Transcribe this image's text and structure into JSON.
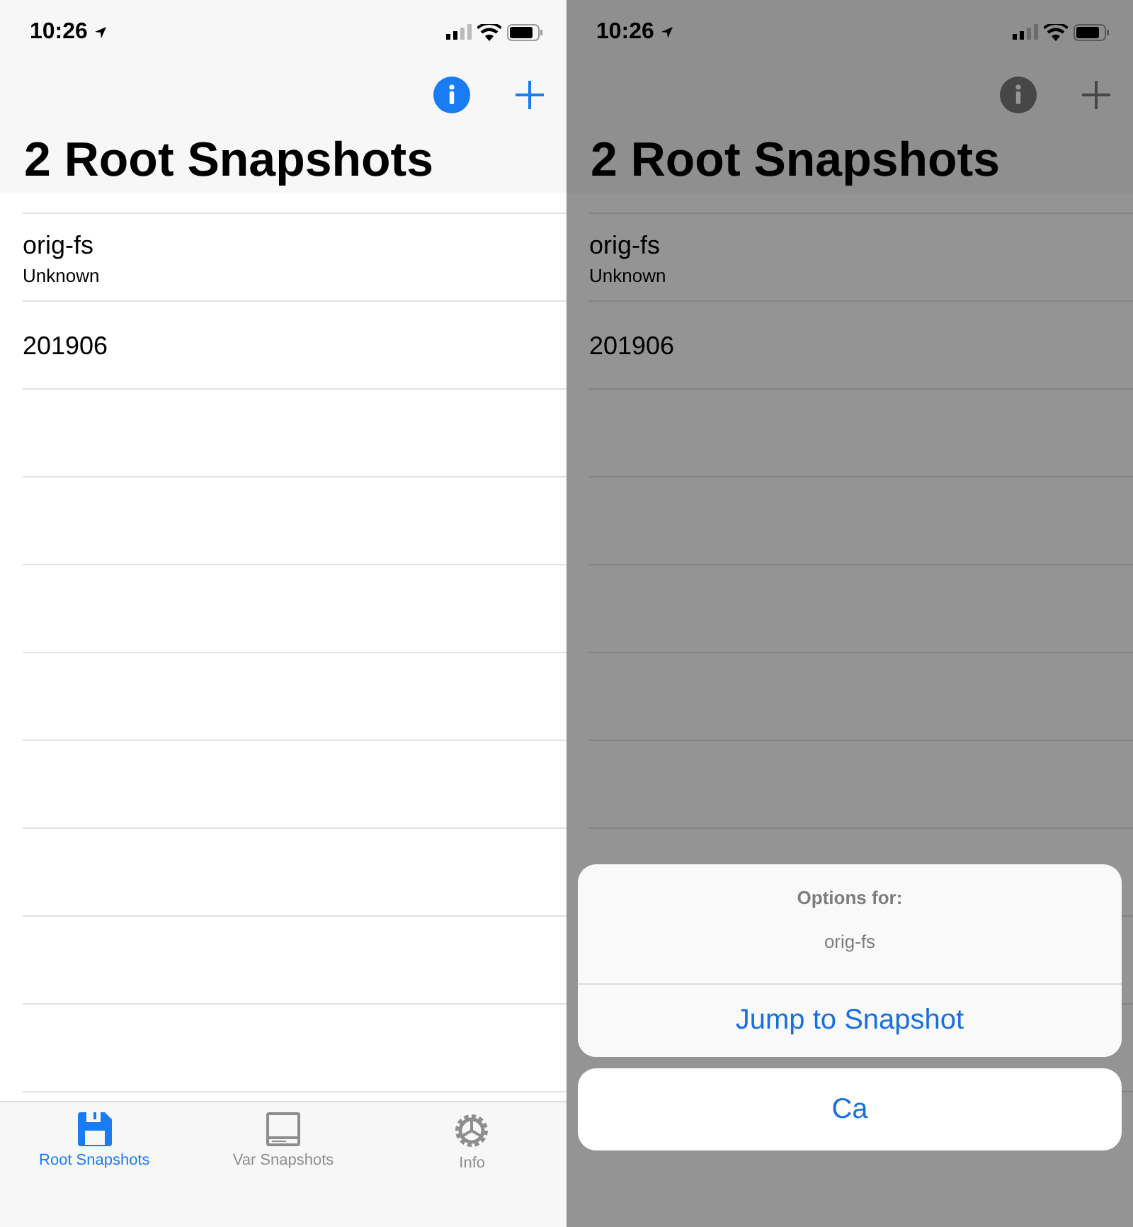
{
  "screens": [
    {
      "dimmed": false,
      "status_bar": {
        "time": "10:26"
      },
      "title": "2 Root Snapshots",
      "rows": [
        {
          "title": "orig-fs",
          "subtitle": "Unknown"
        },
        {
          "title": "201906"
        }
      ],
      "tab_bar": [
        {
          "kind": "floppy",
          "label": "Root Snapshots",
          "selected": true
        },
        {
          "kind": "drive",
          "label": "Var Snapshots",
          "selected": false
        },
        {
          "kind": "gear",
          "label": "Info",
          "selected": false
        }
      ]
    },
    {
      "dimmed": true,
      "status_bar": {
        "time": "10:26"
      },
      "title": "2 Root Snapshots",
      "rows": [
        {
          "title": "orig-fs",
          "subtitle": "Unknown"
        },
        {
          "title": "201906"
        }
      ],
      "action_sheet": {
        "title": "Options for:",
        "message": "orig-fs",
        "actions": [
          "Jump to Snapshot"
        ],
        "cancel": "Ca"
      }
    }
  ]
}
